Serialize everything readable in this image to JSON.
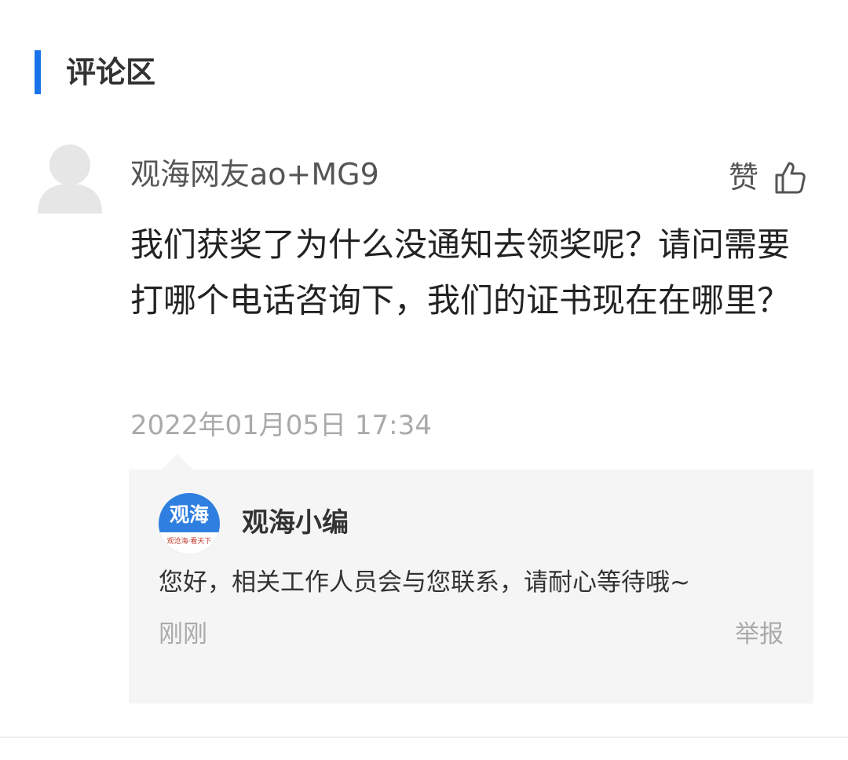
{
  "section": {
    "title": "评论区",
    "accent_color": "#1a73e8"
  },
  "comment": {
    "avatar_icon": "default-user-avatar-icon",
    "username": "观海网友ao+MG9",
    "like_label": "赞",
    "like_icon": "thumbs-up-icon",
    "text": "我们获奖了为什么没通知去领奖呢？请问需要打哪个电话咨询下，我们的证书现在在哪里？",
    "timestamp": "2022年01月05日 17:34"
  },
  "reply": {
    "logo_text": "观海",
    "logo_slogan": "观沧海·看天下",
    "author": "观海小编",
    "text": "您好，相关工作人员会与您联系，请耐心等待哦~",
    "time": "刚刚",
    "report_label": "举报"
  },
  "colors": {
    "logo_blue": "#2f7fe0",
    "reply_background": "#f5f5f5",
    "muted_text": "#aaaaaa"
  }
}
